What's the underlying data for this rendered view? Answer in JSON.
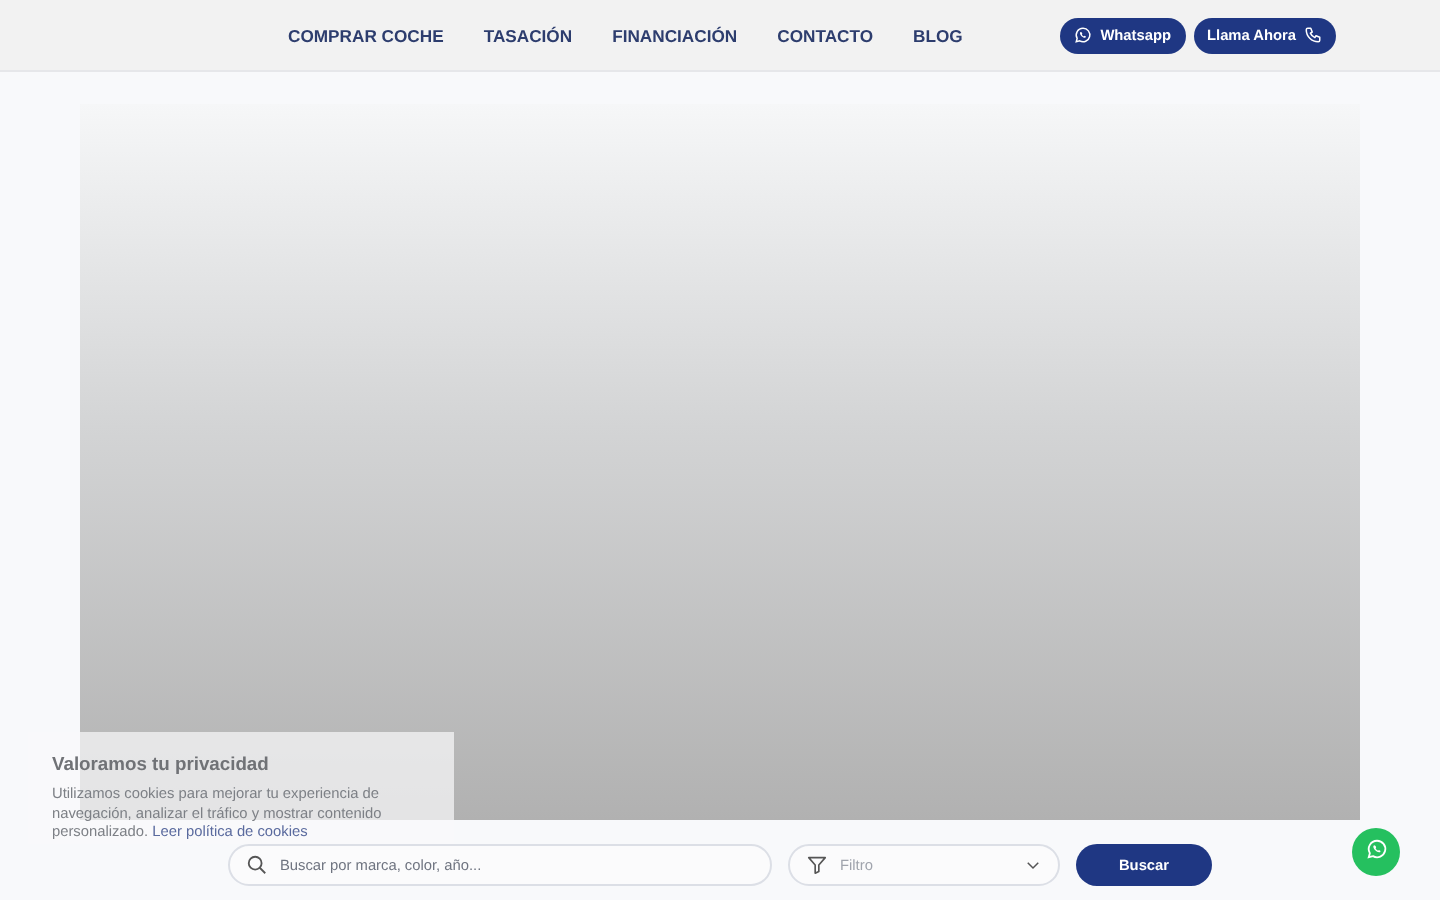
{
  "header": {
    "nav": [
      {
        "label": "COMPRAR COCHE"
      },
      {
        "label": "TASACIÓN"
      },
      {
        "label": "FINANCIACIÓN"
      },
      {
        "label": "CONTACTO"
      },
      {
        "label": "BLOG"
      }
    ],
    "actions": [
      {
        "kind": "whatsapp",
        "label": "Whatsapp"
      },
      {
        "kind": "phone",
        "label": "Llama Ahora"
      }
    ]
  },
  "search": {
    "placeholder": "Buscar por marca, color, año...",
    "filter": "Filtro",
    "button": "Buscar"
  },
  "cookie_notice": {
    "title": "Valoramos tu privacidad",
    "text": "Utilizamos cookies para mejorar tu experiencia de navegación, analizar el tráfico y mostrar contenido personalizado.",
    "link": "Leer política de cookies"
  }
}
